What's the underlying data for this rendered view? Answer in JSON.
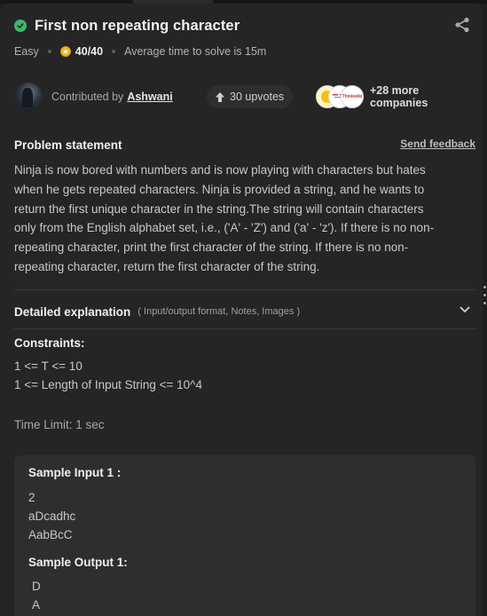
{
  "problem": {
    "title": "First non repeating character",
    "difficulty": "Easy",
    "score": "40/40",
    "avg_time": "Average time to solve is 15m",
    "share_icon": "share-icon",
    "solved_icon": "check-circle-icon"
  },
  "contributor": {
    "label": "Contributed by",
    "name": "Ashwani",
    "upvotes": "30 upvotes",
    "more_companies": "+28 more companies",
    "company_logo_text": "Thinkwiki"
  },
  "statement": {
    "title": "Problem statement",
    "feedback": "Send feedback",
    "lines": [
      "Ninja is now bored with numbers and is now playing with characters but hates",
      "when he gets repeated characters. Ninja is provided a string, and he wants to",
      "return the first unique character in the string.The string will contain characters",
      "only from the English alphabet set, i.e., ('A' - 'Z') and ('a' - 'z'). If there is no non-",
      "repeating character, print the first character of the string. If there is no non-",
      "repeating character, return the first character of the string."
    ]
  },
  "detailed": {
    "title": "Detailed explanation",
    "subtitle": "( Input/output format, Notes, Images )"
  },
  "constraints": {
    "title": "Constraints:",
    "lines": [
      "1 <= T <= 10",
      "1 <= Length of Input String <= 10^4"
    ],
    "time_limit": "Time Limit: 1 sec"
  },
  "sample": {
    "input_title": "Sample Input 1 :",
    "input_lines": [
      "2",
      "aDcadhc",
      "AabBcC"
    ],
    "output_title": "Sample Output 1:",
    "output_lines": [
      "D",
      "A"
    ]
  },
  "colors": {
    "background": "#1e1e1e",
    "panel": "#252525",
    "accent_green": "#3fb56b",
    "coin": "#f1b727"
  }
}
